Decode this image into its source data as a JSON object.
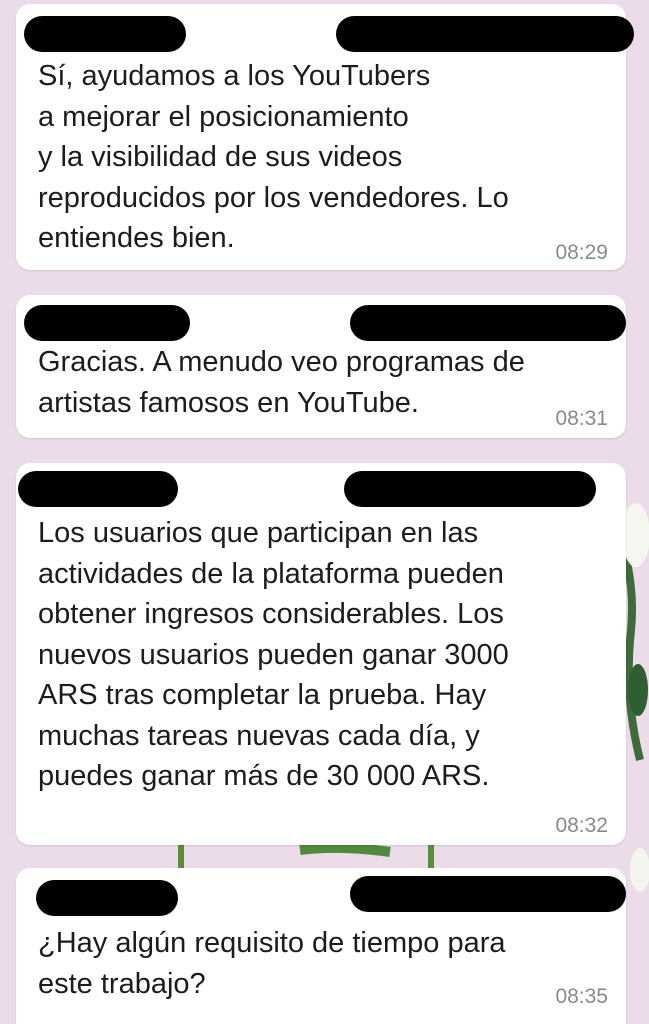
{
  "chat": {
    "messages": [
      {
        "text": "Sí, ayudamos a los YouTubers\na mejorar el posicionamiento\ny la visibilidad de sus videos\nreproducidos por los vendedores. Lo\nentiendes bien.",
        "time": "08:29"
      },
      {
        "text": "Gracias. A menudo veo programas de\nartistas famosos en YouTube.",
        "time": "08:31"
      },
      {
        "text": "Los usuarios que participan en las\nactividades de la plataforma pueden\nobtener ingresos considerables. Los\nnuevos usuarios pueden ganar 3000\nARS tras completar la prueba. Hay\nmuchas tareas nuevas cada día, y\npuedes ganar más de 30 000 ARS.",
        "time": "08:32"
      },
      {
        "text": "¿Hay algún requisito de tiempo para\neste trabajo?",
        "time": "08:35"
      }
    ]
  },
  "colors": {
    "background": "#ecdcea",
    "bubble": "#ffffff",
    "redaction": "#000000",
    "timestamp": "#8a8a8a"
  }
}
